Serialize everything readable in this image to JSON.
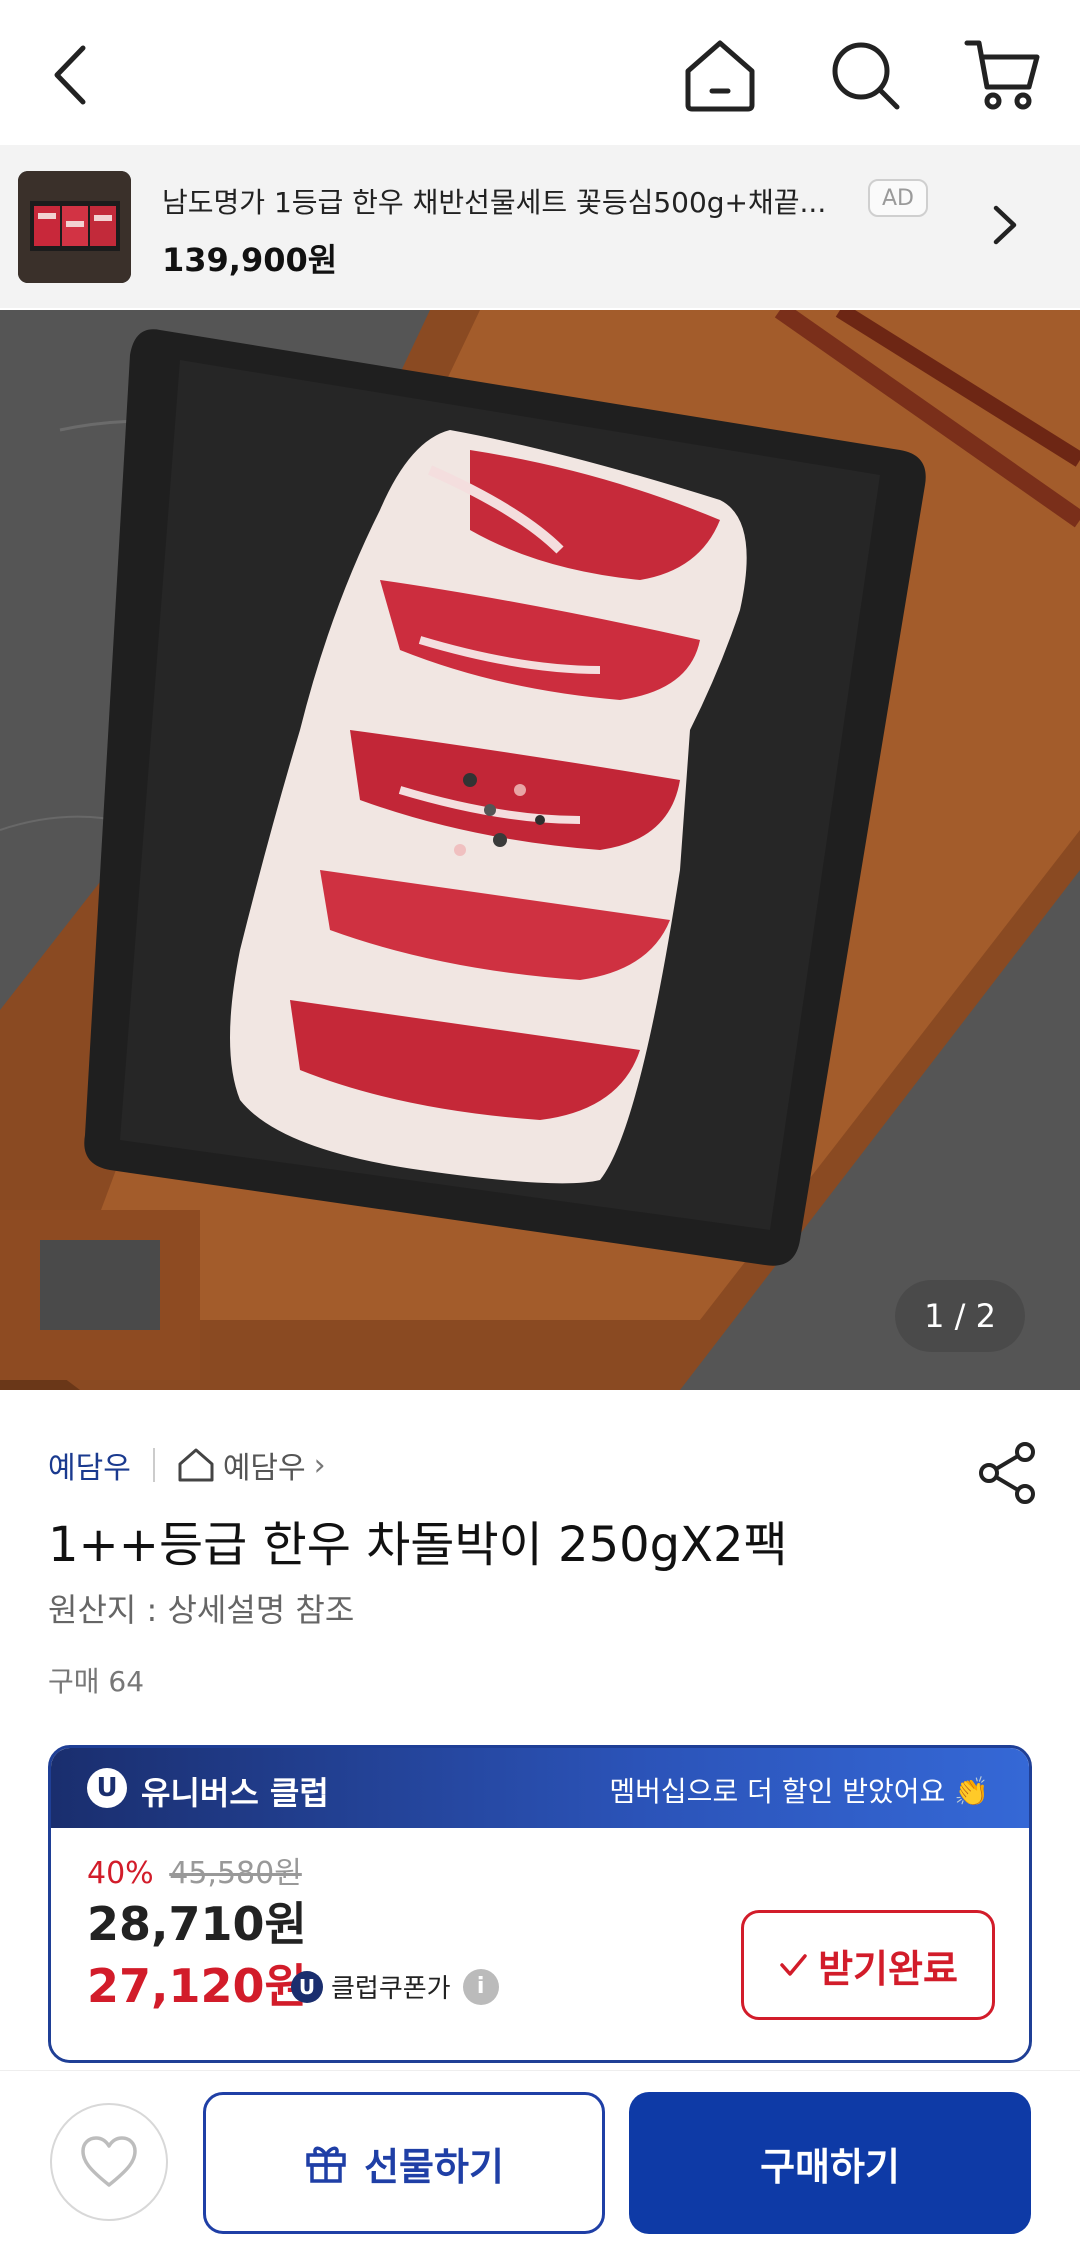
{
  "ad": {
    "title": "남도명가 1등급 한우 채반선물세트 꽃등심500g+채끝...",
    "badge": "AD",
    "price": "139,900원"
  },
  "hero": {
    "counter": "1 / 2"
  },
  "store": {
    "name": "예담우",
    "home_name": "예담우",
    "home_arrow": "›"
  },
  "product": {
    "title": "1++등급 한우 차돌박이 250gX2팩",
    "origin": "원산지 : 상세설명 참조",
    "purchases": "구매 64"
  },
  "club": {
    "badge": "U",
    "name": "유니버스 클럽",
    "message": "멤버십으로 더 할인 받았어요 👏",
    "discount_rate": "40%",
    "original_price": "45,580원",
    "sale_price": "28,710원",
    "coupon_price": "27,120원",
    "coupon_label": "클럽쿠폰가",
    "info": "i",
    "received_label": "받기완료"
  },
  "actions": {
    "gift_label": "선물하기",
    "buy_label": "구매하기"
  },
  "colors": {
    "brand_blue": "#0e3aa6",
    "accent_red": "#d21c2a"
  }
}
